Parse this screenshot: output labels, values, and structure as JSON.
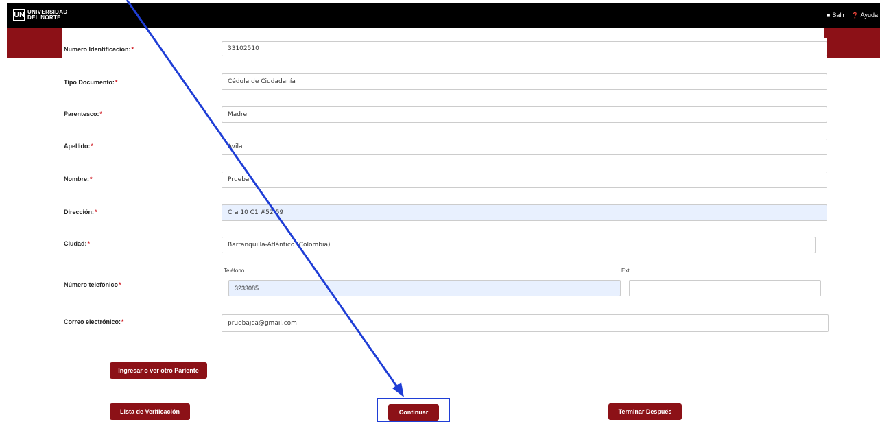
{
  "header": {
    "logo_mark": "UN",
    "logo_line1": "UNIVERSIDAD",
    "logo_line2": "DEL NORTE",
    "salir_label": "Salir",
    "separator": "|",
    "ayuda_label": "Ayuda"
  },
  "form": {
    "numero_identificacion": {
      "label": "Numero Identificacion:",
      "value": "33102510"
    },
    "tipo_documento": {
      "label": "Tipo Documento:",
      "value": "Cédula de Ciudadanía"
    },
    "parentesco": {
      "label": "Parentesco:",
      "value": "Madre"
    },
    "apellido": {
      "label": "Apellido:",
      "value": "Avila"
    },
    "nombre": {
      "label": "Nombre:",
      "value": "Prueba"
    },
    "direccion": {
      "label": "Dirección:",
      "value": "Cra 10 C1 #52-59"
    },
    "ciudad": {
      "label": "Ciudad:",
      "value": "Barranquilla-Atlántico (Colombia)"
    },
    "telefono": {
      "label": "Número telefónico",
      "sub_telefono": "Teléfono",
      "value": "3233085",
      "sub_ext": "Ext",
      "ext_value": ""
    },
    "correo": {
      "label": "Correo electrónico:",
      "value": "pruebajca@gmail.com"
    },
    "required_mark": "*"
  },
  "buttons": {
    "otro_pariente": "Ingresar o ver otro Pariente",
    "lista": "Lista de Verificación",
    "continuar": "Continuar",
    "terminar": "Terminar Después"
  },
  "colors": {
    "brand_red": "#8c1117",
    "annotation_blue": "#1f3ed6"
  }
}
